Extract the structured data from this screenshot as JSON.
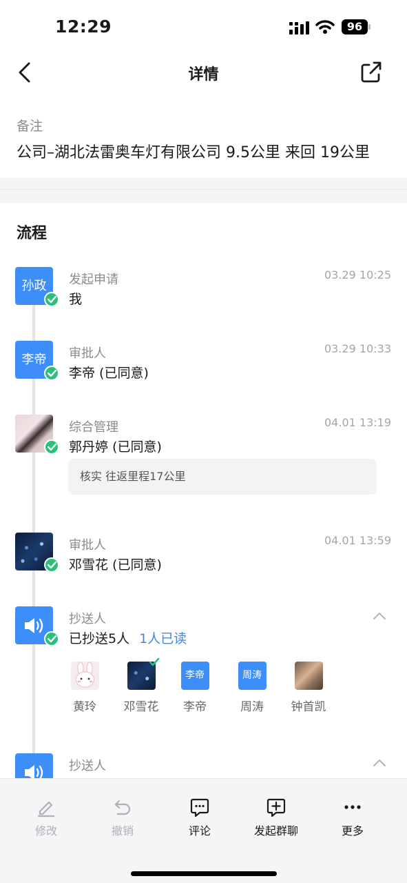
{
  "status_bar": {
    "time": "12:29",
    "battery": "96"
  },
  "nav": {
    "title": "详情"
  },
  "remark": {
    "label": "备注",
    "value": "公司–湖北法雷奥车灯有限公司 9.5公里 来回 19公里"
  },
  "flow": {
    "title": "流程",
    "steps": [
      {
        "role": "发起申请",
        "name": "我",
        "time": "03.29 10:25",
        "avatar_text": "孙政",
        "status": "approved"
      },
      {
        "role": "审批人",
        "name": "李帝 (已同意)",
        "time": "03.29 10:33",
        "avatar_text": "李帝",
        "status": "approved"
      },
      {
        "role": "综合管理",
        "name": "郭丹婷 (已同意)",
        "time": "04.01 13:19",
        "comment": "核实 往返里程17公里",
        "status": "approved"
      },
      {
        "role": "审批人",
        "name": "邓雪花 (已同意)",
        "time": "04.01 13:59",
        "status": "approved"
      },
      {
        "role": "抄送人",
        "name": "已抄送5人",
        "read_text": "1人已读",
        "status": "sent",
        "cc": [
          {
            "name": "黄玲"
          },
          {
            "name": "邓雪花",
            "read": true
          },
          {
            "name": "李帝",
            "avatar_text": "李帝"
          },
          {
            "name": "周涛",
            "avatar_text": "周涛"
          },
          {
            "name": "钟首凯"
          }
        ]
      },
      {
        "role": "抄送人",
        "status": "sent"
      }
    ]
  },
  "toolbar": {
    "items": [
      {
        "label": "修改",
        "icon": "edit-icon",
        "enabled": false
      },
      {
        "label": "撤销",
        "icon": "undo-icon",
        "enabled": false
      },
      {
        "label": "评论",
        "icon": "comment-icon",
        "enabled": true
      },
      {
        "label": "发起群聊",
        "icon": "group-chat-icon",
        "enabled": true
      },
      {
        "label": "更多",
        "icon": "more-icon",
        "enabled": true
      }
    ]
  },
  "colors": {
    "accent": "#3d8ef8",
    "success": "#2bbf7a",
    "link": "#4a86d8"
  }
}
